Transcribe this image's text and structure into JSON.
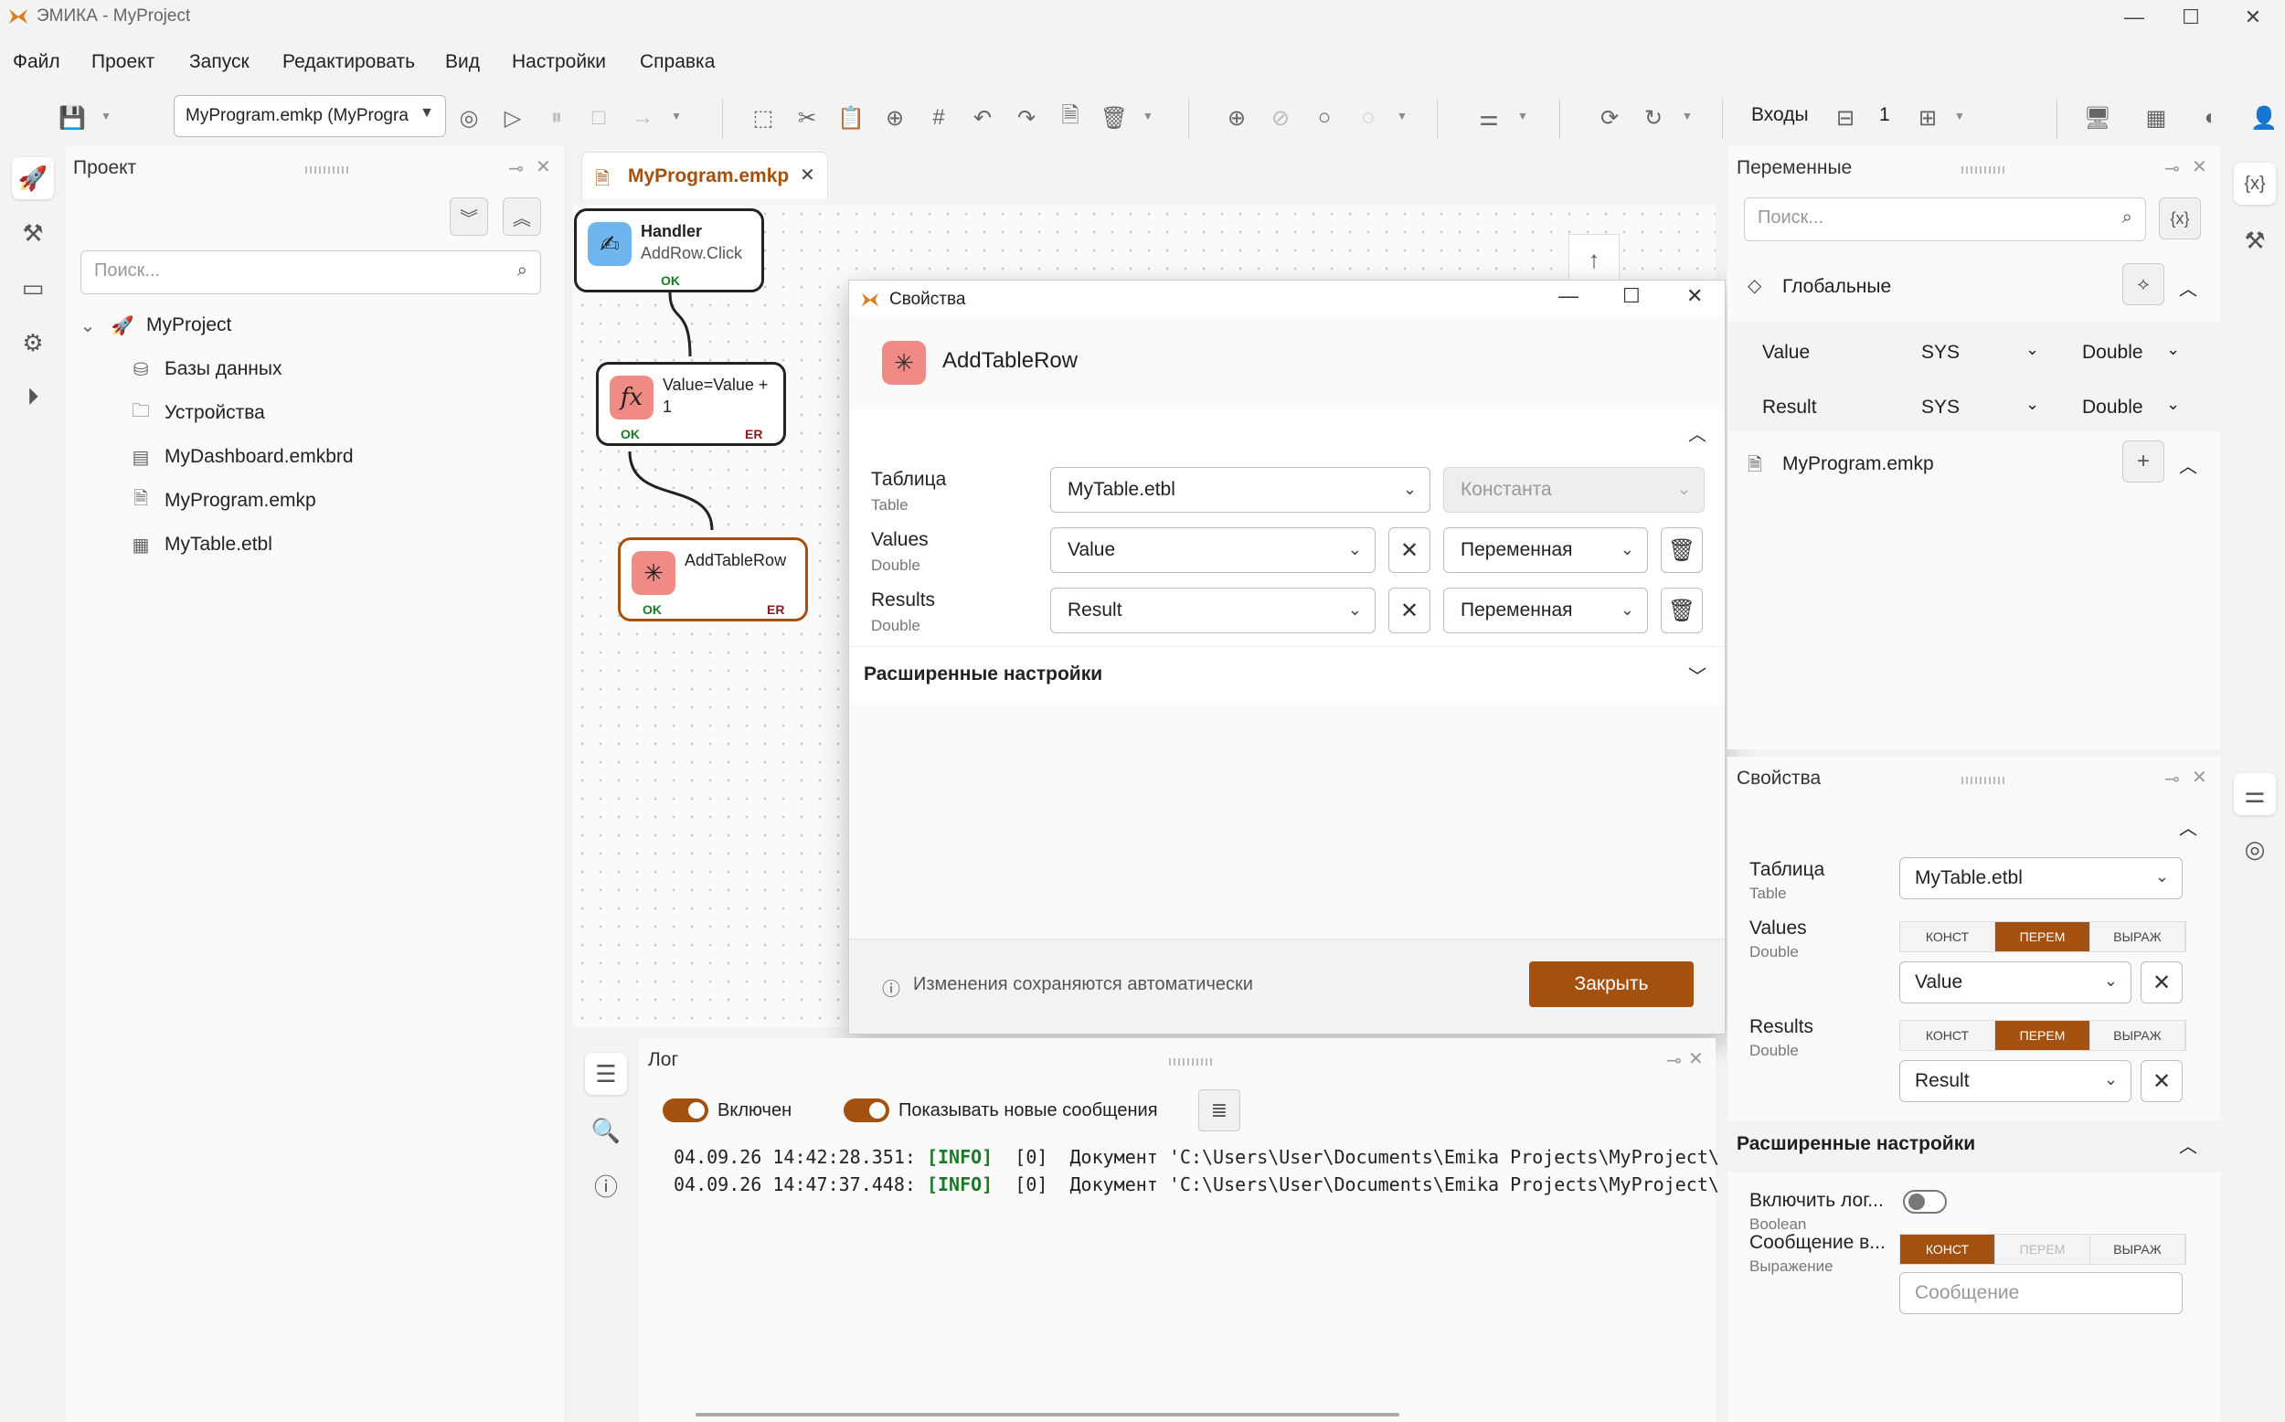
{
  "window": {
    "title": "ЭМИКА - MyProject",
    "controls": {
      "minimize": "—",
      "maximize": "☐",
      "close": "✕"
    }
  },
  "menu": [
    "Файл",
    "Проект",
    "Запуск",
    "Редактировать",
    "Вид",
    "Настройки",
    "Справка"
  ],
  "toolbar": {
    "program_select": "MyProgram.emkp (MyProgra",
    "inputs_label": "Входы",
    "inputs_value": "1"
  },
  "project_panel": {
    "title": "Проект",
    "search_placeholder": "Поиск...",
    "root": "MyProject",
    "items": [
      "Базы данных",
      "Устройства",
      "MyDashboard.emkbrd",
      "MyProgram.emkp",
      "MyTable.etbl"
    ]
  },
  "editor": {
    "tab_label": "MyProgram.emkp",
    "nodes": [
      {
        "title": "Handler",
        "subtitle": "AddRow.Click",
        "ports": [
          "OK"
        ]
      },
      {
        "title": "Value=Value +",
        "subtitle": "1",
        "ports": [
          "OK",
          "ER"
        ]
      },
      {
        "title": "AddTableRow",
        "subtitle": "",
        "ports": [
          "OK",
          "ER"
        ]
      }
    ]
  },
  "dialog": {
    "window_title": "Свойства",
    "heading": "AddTableRow",
    "rows": [
      {
        "label": "Таблица",
        "type": "Table",
        "value": "MyTable.etbl",
        "mode": "Константа"
      },
      {
        "label": "Values",
        "type": "Double",
        "value": "Value",
        "mode": "Переменная"
      },
      {
        "label": "Results",
        "type": "Double",
        "value": "Result",
        "mode": "Переменная"
      }
    ],
    "advanced": "Расширенные настройки",
    "footer_note": "Изменения сохраняются автоматически",
    "close_button": "Закрыть"
  },
  "log": {
    "title": "Лог",
    "toggle_enabled": "Включен",
    "toggle_new": "Показывать новые сообщения",
    "lines": [
      {
        "time": "04.09.26 14:42:28.351:",
        "level": "[INFO]",
        "text": "  [0]  Документ 'C:\\Users\\User\\Documents\\Emika Projects\\MyProject\\"
      },
      {
        "time": "04.09.26 14:47:37.448:",
        "level": "[INFO]",
        "text": "  [0]  Документ 'C:\\Users\\User\\Documents\\Emika Projects\\MyProject\\"
      }
    ]
  },
  "variables": {
    "title": "Переменные",
    "search_placeholder": "Поиск...",
    "global_label": "Глобальные",
    "rows": [
      {
        "name": "Value",
        "scope": "SYS",
        "type": "Double"
      },
      {
        "name": "Result",
        "scope": "SYS",
        "type": "Double"
      }
    ],
    "program_label": "MyProgram.emkp"
  },
  "properties": {
    "title": "Свойства",
    "table_label": "Таблица",
    "table_type": "Table",
    "table_value": "MyTable.etbl",
    "values_label": "Values",
    "values_type": "Double",
    "values_value": "Value",
    "results_label": "Results",
    "results_type": "Double",
    "results_value": "Result",
    "seg": [
      "КОНСТ",
      "ПЕРЕМ",
      "ВЫРАЖ"
    ],
    "advanced": "Расширенные настройки",
    "log_label": "Включить лог...",
    "log_type": "Boolean",
    "msg_label": "Сообщение в...",
    "msg_type": "Выражение",
    "msg_placeholder": "Сообщение"
  },
  "colors": {
    "accent": "#a4500f",
    "ok": "#1b7a26",
    "er": "#8a1c1c"
  }
}
